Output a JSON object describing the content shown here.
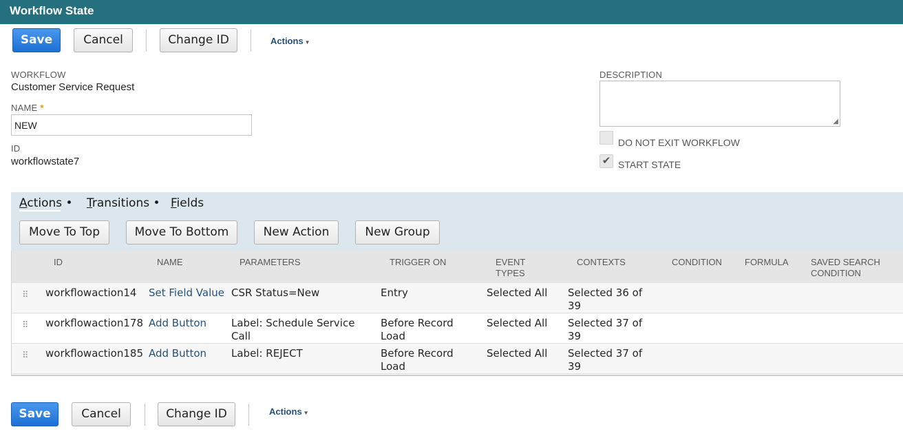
{
  "header": {
    "title": "Workflow State"
  },
  "toolbar_top": {
    "save": "Save",
    "cancel": "Cancel",
    "change_id": "Change ID",
    "actions": "Actions"
  },
  "toolbar_bottom": {
    "save": "Save",
    "cancel": "Cancel",
    "change_id": "Change ID",
    "actions": "Actions"
  },
  "fields": {
    "workflow_label": "WORKFLOW",
    "workflow_value": "Customer Service Request",
    "name_label": "NAME",
    "name_required": "*",
    "name_value": "NEW",
    "id_label": "ID",
    "id_value": "workflowstate7",
    "description_label": "DESCRIPTION",
    "description_value": "",
    "do_not_exit_label": "DO NOT EXIT WORKFLOW",
    "do_not_exit_checked": false,
    "start_state_label": "START STATE",
    "start_state_checked": true
  },
  "subtabs": [
    {
      "first": "A",
      "rest": "ctions",
      "bullet": "•"
    },
    {
      "first": "T",
      "rest": "ransitions",
      "bullet": "•"
    },
    {
      "first": "F",
      "rest": "ields",
      "bullet": ""
    }
  ],
  "subtab_buttons": {
    "move_top": "Move To Top",
    "move_bottom": "Move To Bottom",
    "new_action": "New Action",
    "new_group": "New Group"
  },
  "table": {
    "headers": {
      "id": "ID",
      "name": "NAME",
      "parameters": "PARAMETERS",
      "trigger_on": "TRIGGER ON",
      "event_types_1": "EVENT",
      "event_types_2": "TYPES",
      "contexts": "CONTEXTS",
      "condition": "CONDITION",
      "formula": "FORMULA",
      "saved_search_1": "SAVED SEARCH",
      "saved_search_2": "CONDITION"
    },
    "rows": [
      {
        "id": "workflowaction14",
        "name": "Set Field Value",
        "param_1": "CSR Status=New",
        "param_2": "",
        "trigger_1": "Entry",
        "trigger_2": "",
        "event": "Selected All",
        "context_1": "Selected 36 of",
        "context_2": "39"
      },
      {
        "id": "workflowaction178",
        "name": "Add Button",
        "param_1": "Label: Schedule Service",
        "param_2": "Call",
        "trigger_1": "Before Record",
        "trigger_2": "Load",
        "event": "Selected All",
        "context_1": "Selected 37 of",
        "context_2": "39"
      },
      {
        "id": "workflowaction185",
        "name": "Add Button",
        "param_1": "Label: REJECT",
        "param_2": "",
        "trigger_1": "Before Record",
        "trigger_2": "Load",
        "event": "Selected All",
        "context_1": "Selected 37 of",
        "context_2": "39"
      }
    ]
  },
  "colors": {
    "header_bg": "#24707f",
    "primary_button": "#1c6fd6",
    "subtab_panel": "#dbe7ec",
    "link": "#24517a"
  }
}
